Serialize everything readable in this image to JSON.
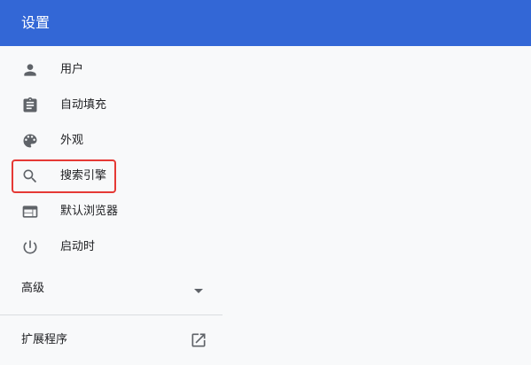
{
  "header": {
    "title": "设置"
  },
  "sidebar": {
    "items": [
      {
        "label": "用户",
        "icon": "person-icon"
      },
      {
        "label": "自动填充",
        "icon": "clipboard-icon"
      },
      {
        "label": "外观",
        "icon": "palette-icon"
      },
      {
        "label": "搜索引擎",
        "icon": "search-icon",
        "highlighted": true
      },
      {
        "label": "默认浏览器",
        "icon": "browser-window-icon"
      },
      {
        "label": "启动时",
        "icon": "power-icon"
      }
    ],
    "advanced": {
      "label": "高级",
      "icon": "caret-down-icon"
    },
    "extensions": {
      "label": "扩展程序",
      "icon": "open-in-new-icon"
    }
  },
  "colors": {
    "header": "#3367d6",
    "icon": "#5f6368",
    "highlight": "#e53935"
  }
}
